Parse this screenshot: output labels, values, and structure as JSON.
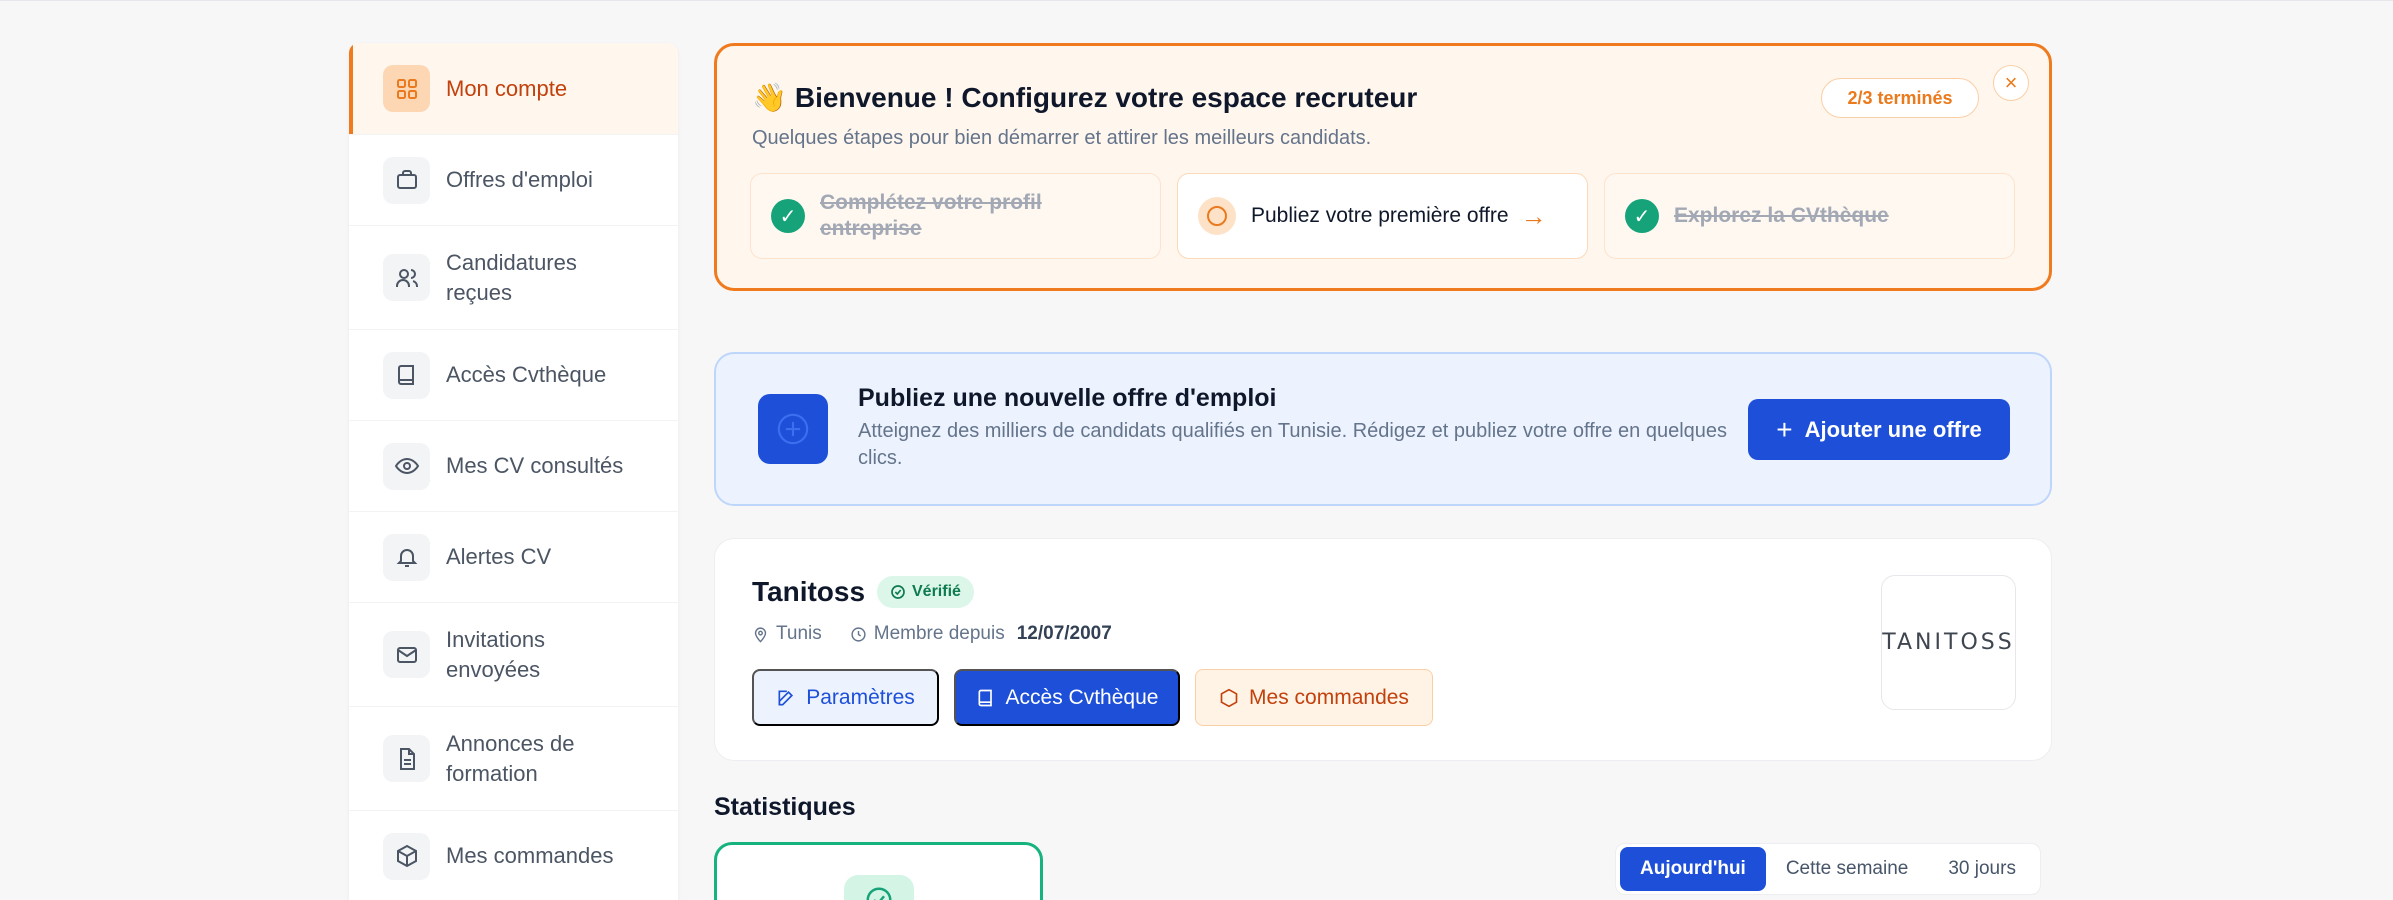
{
  "sidebar": {
    "items": [
      {
        "label": "Mon compte",
        "icon": "dashboard-grid-icon",
        "active": true
      },
      {
        "label": "Offres d'emploi",
        "icon": "briefcase-icon"
      },
      {
        "label": "Candidatures reçues",
        "icon": "users-icon"
      },
      {
        "label": "Accès Cvthèque",
        "icon": "book-icon"
      },
      {
        "label": "Mes CV consultés",
        "icon": "eye-icon"
      },
      {
        "label": "Alertes CV",
        "icon": "bell-icon"
      },
      {
        "label": "Invitations envoyées",
        "icon": "mail-icon"
      },
      {
        "label": "Annonces de formation",
        "icon": "document-icon"
      },
      {
        "label": "Mes commandes",
        "icon": "package-icon"
      }
    ]
  },
  "onboarding": {
    "emoji": "👋",
    "title": "Bienvenue ! Configurez votre espace recruteur",
    "subtitle": "Quelques étapes pour bien démarrer et attirer les meilleurs candidats.",
    "progress": "2/3 terminés",
    "close": "×",
    "steps": [
      {
        "label": "Complétez votre profil entreprise",
        "done": true
      },
      {
        "label": "Publiez votre première offre",
        "done": false,
        "arrow": "→"
      },
      {
        "label": "Explorez la CVthèque",
        "done": true
      }
    ]
  },
  "publish": {
    "title": "Publiez une nouvelle offre d'emploi",
    "description": "Atteignez des milliers de candidats qualifiés en Tunisie. Rédigez et publiez votre offre en quelques clics.",
    "button_plus": "+",
    "button_label": "Ajouter une offre"
  },
  "company": {
    "name": "Tanitoss",
    "verified_label": "Vérifié",
    "location": "Tunis",
    "member_since_label": "Membre depuis",
    "member_since_date": "12/07/2007",
    "buttons": {
      "params": "Paramètres",
      "cvtheque": "Accès Cvthèque",
      "orders": "Mes commandes"
    },
    "logo_text": "TANITOSS"
  },
  "stats": {
    "title": "Statistiques",
    "periods": [
      "Aujourd'hui",
      "Cette semaine",
      "30 jours"
    ],
    "active_period": "Aujourd'hui"
  },
  "colors": {
    "accent_orange": "#f07a1e",
    "accent_blue": "#1d4fd8",
    "success_green": "#16a37a"
  }
}
